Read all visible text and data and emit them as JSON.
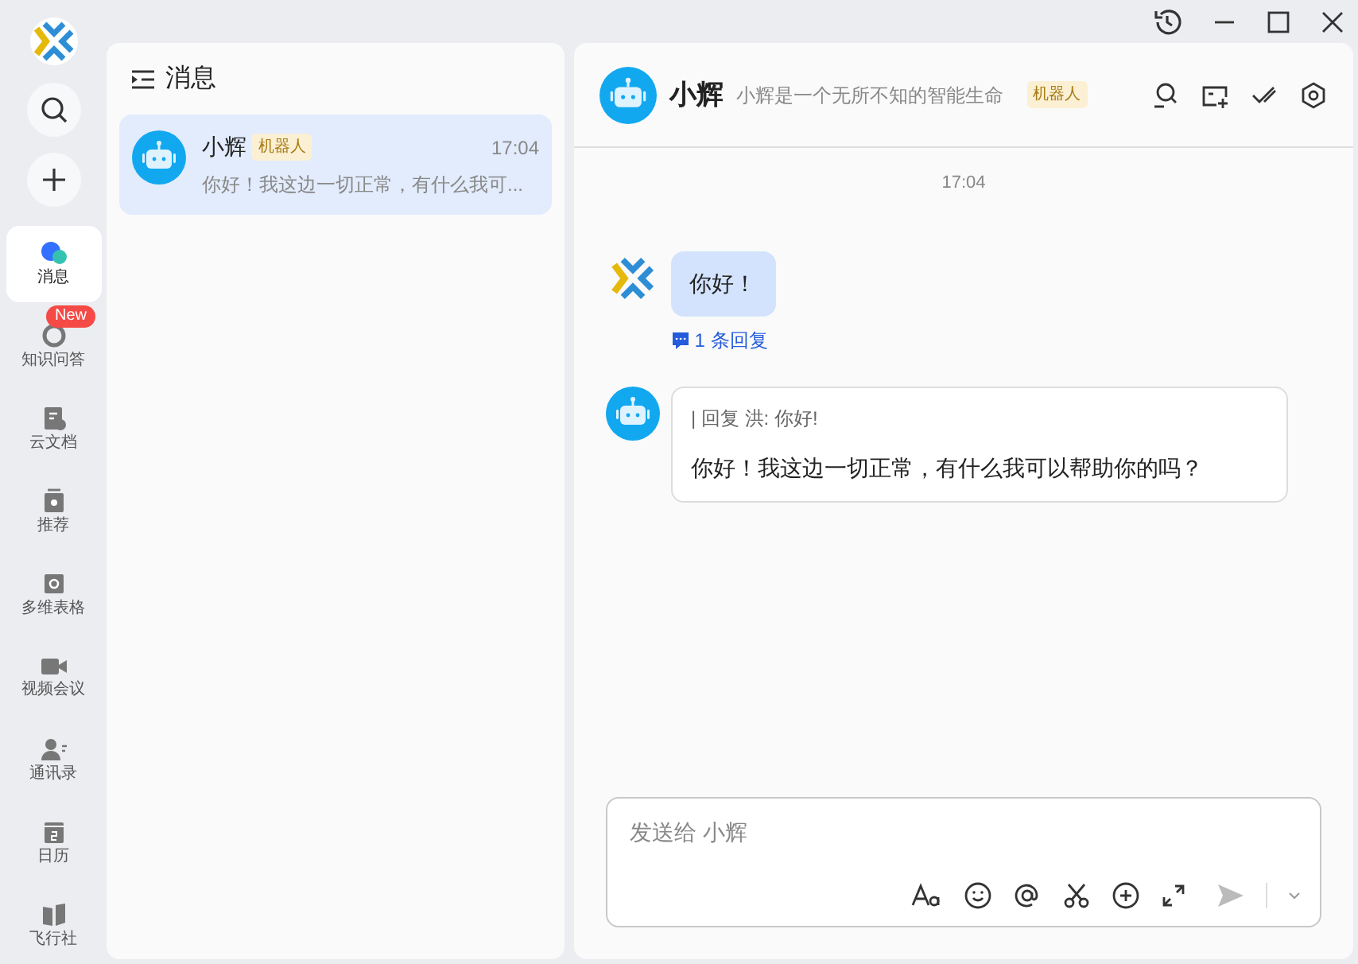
{
  "nav": [
    {
      "kind": "chat",
      "label": "消息",
      "selected": true
    },
    {
      "kind": "qa",
      "label": "知识问答",
      "selected": false,
      "badge": "New"
    },
    {
      "kind": "doc",
      "label": "云文档",
      "selected": false
    },
    {
      "kind": "recommend",
      "label": "推荐",
      "selected": false
    },
    {
      "kind": "table",
      "label": "多维表格",
      "selected": false
    },
    {
      "kind": "video",
      "label": "视频会议",
      "selected": false
    },
    {
      "kind": "contacts",
      "label": "通讯录",
      "selected": false
    },
    {
      "kind": "calendar",
      "label": "日历",
      "selected": false
    },
    {
      "kind": "community",
      "label": "飞行社",
      "selected": false
    }
  ],
  "conversations": {
    "title": "消息",
    "items": [
      {
        "name": "小辉",
        "tag": "机器人",
        "time": "17:04",
        "preview": "你好！我这边一切正常，有什么我可...",
        "selected": true
      }
    ]
  },
  "chat": {
    "name": "小辉",
    "description": "小辉是一个无所不知的智能生命",
    "tag": "机器人",
    "time": "17:04",
    "messages": [
      {
        "kind": "user",
        "text": "你好！",
        "replies": "1 条回复"
      },
      {
        "kind": "bot",
        "quote": "| 回复 洪:  你好!",
        "text": "你好！我这边一切正常，有什么我可以帮助你的吗？"
      }
    ],
    "input": {
      "placeholder": "发送给 小辉"
    }
  }
}
